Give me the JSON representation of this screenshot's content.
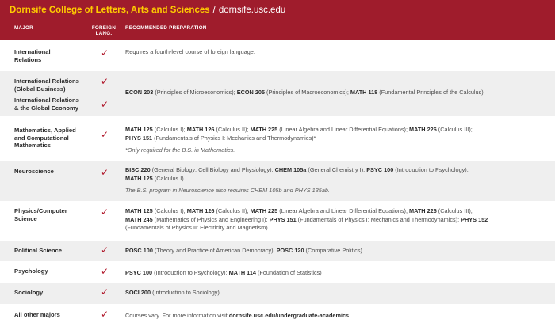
{
  "banner": {
    "college": "Dornsife College of Letters, Arts and Sciences",
    "separator": "/",
    "url": "dornsife.usc.edu"
  },
  "headers": {
    "major": "MAJOR",
    "lang_line1": "FOREIGN",
    "lang_line2": "LANG.",
    "prep": "RECOMMENDED PREPARATION"
  },
  "check": "✓",
  "rows": {
    "intl": {
      "major_l1": "International",
      "major_l2": "Relations",
      "prep": "Requires a fourth-level course of foreign language."
    },
    "intl_gb": {
      "major_a_l1": "International Relations",
      "major_a_l2": "(Global Business)",
      "major_b_l1": "International Relations",
      "major_b_l2": "& the Global Economy",
      "c1": "ECON 203",
      "t1": " (Principles of Microeconomics); ",
      "c2": "ECON 205",
      "t2": " (Principles of Macroeconomics); ",
      "c3": "MATH 118",
      "t3": " (Fundamental Principles of the Calculus)"
    },
    "math": {
      "major_l1": "Mathematics, Applied",
      "major_l2": "and Computational",
      "major_l3": "Mathematics",
      "c1": "MATH 125",
      "t1": " (Calculus I); ",
      "c2": "MATH 126",
      "t2": " (Calculus II); ",
      "c3": "MATH 225",
      "t3": " (Linear Algebra and Linear Differential Equations); ",
      "c4": "MATH 226",
      "t4": " (Calculus III); ",
      "c5": "PHYS 151",
      "t5": " (Fundamentals of Physics I: Mechanics and Thermodynamics)*",
      "note": "*Only required for the B.S. in Mathematics."
    },
    "neuro": {
      "major_l1": "Neuroscience",
      "c1": "BISC 220",
      "t1": " (General Biology: Cell Biology and Physiology); ",
      "c2": "CHEM 105a",
      "t2": " (General Chemistry I); ",
      "c3": "PSYC 100",
      "t3": " (Introduction to Psychology);",
      "c4": "MATH 125",
      "t4": " (Calculus I)",
      "note": "The B.S. program in Neuroscience also requires CHEM 105b and PHYS 135ab."
    },
    "physics": {
      "major_l1": "Physics/Computer",
      "major_l2": "Science",
      "c1": "MATH 125",
      "t1": " (Calculus I); ",
      "c2": "MATH 126",
      "t2": " (Calculus II); ",
      "c3": "MATH 225",
      "t3": " (Linear Algebra and Linear Differential Equations); ",
      "c4": "MATH 226",
      "t4": " (Calculus III);",
      "c5": "MATH 245",
      "t5": " (Mathematics of Physics and Engineering I); ",
      "c6": "PHYS 151",
      "t6": " (Fundamentals of Physics I: Mechanics and Thermodynamics); ",
      "c7": "PHYS 152",
      "t7": "(Fundamentals of Physics II: Electricity and Magnetism)"
    },
    "polisci": {
      "major_l1": "Political Science",
      "c1": "POSC 100",
      "t1": " (Theory and Practice of American Democracy); ",
      "c2": "POSC 120",
      "t2": " (Comparative Politics)"
    },
    "psych": {
      "major_l1": "Psychology",
      "c1": "PSYC 100",
      "t1": " (Introduction to Psychology); ",
      "c2": "MATH 114",
      "t2": " (Foundation of Statistics)"
    },
    "soc": {
      "major_l1": "Sociology",
      "c1": "SOCI 200",
      "t1": " (Introduction to Sociology)"
    },
    "other": {
      "major_l1": "All other majors",
      "t1": "Courses vary. For more information visit ",
      "link": "dornsife.usc.edu/undergraduate-academics",
      "t2": "."
    }
  }
}
